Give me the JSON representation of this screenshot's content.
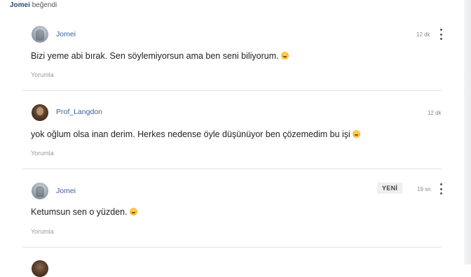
{
  "liked": {
    "user": "Jomei",
    "text": "beğendi"
  },
  "comments": [
    {
      "user": "Jomei",
      "avatar": "jomei",
      "time": "12 dk",
      "new": false,
      "menu": true,
      "text": "Bizi yeme abi bırak. Sen söylemiyorsun ama ben seni biliyorum.",
      "emoji": "grin-emoji",
      "reply": "Yorumla"
    },
    {
      "user": "Prof_Langdon",
      "avatar": "prof",
      "time": "12 dk",
      "new": false,
      "menu": false,
      "text": "yok oğlum olsa inan derim. Herkes nedense öyle düşünüyor ben çözemedim bu işi",
      "emoji": "grin-emoji",
      "reply": "Yorumla"
    },
    {
      "user": "Jomei",
      "avatar": "jomei",
      "time": "19 sn",
      "new": true,
      "menu": true,
      "badge": "YENİ",
      "text": "Ketumsun sen o yüzden.",
      "emoji": "grin-emoji",
      "reply": "Yorumla"
    }
  ],
  "colors": {
    "username": "#3a5f9a",
    "separator": "#e4e4e4",
    "emoji": "#f5b733"
  }
}
